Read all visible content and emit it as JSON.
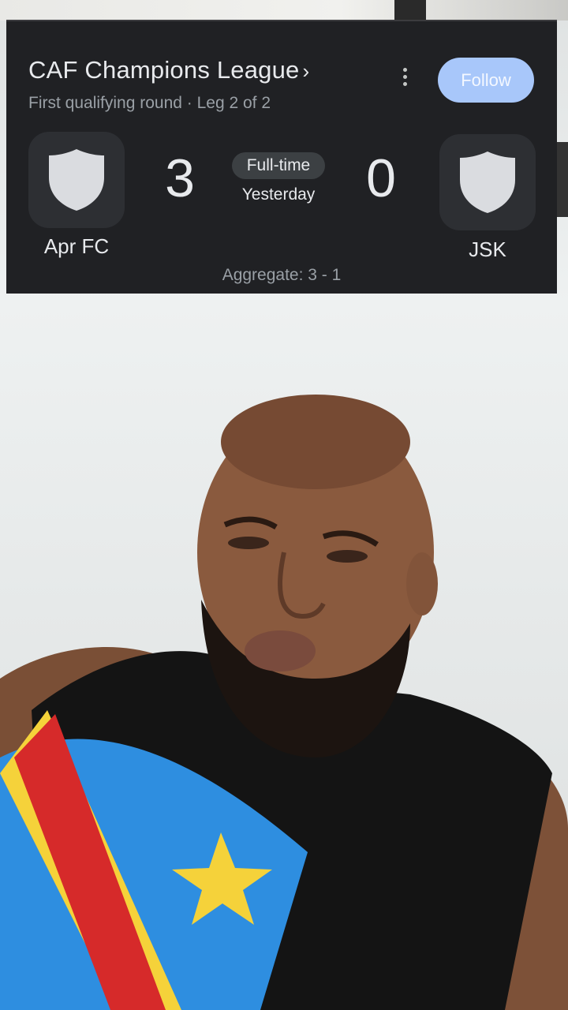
{
  "card": {
    "league": "CAF Champions League",
    "league_chevron": "›",
    "subtitle": "First qualifying round · Leg 2 of 2",
    "more_icon": "more-vert-icon",
    "follow_label": "Follow",
    "home": {
      "name": "Apr FC",
      "score": "3",
      "crest_icon": "shield-icon"
    },
    "away": {
      "name": "JSK",
      "score": "0",
      "crest_icon": "shield-icon"
    },
    "status": "Full-time",
    "date": "Yesterday",
    "aggregate": "Aggregate: 3 - 1"
  },
  "colors": {
    "card_bg": "#202124",
    "follow_bg": "#a8c7fa",
    "badge_bg": "#3c4043",
    "shield": "#dadce0"
  }
}
